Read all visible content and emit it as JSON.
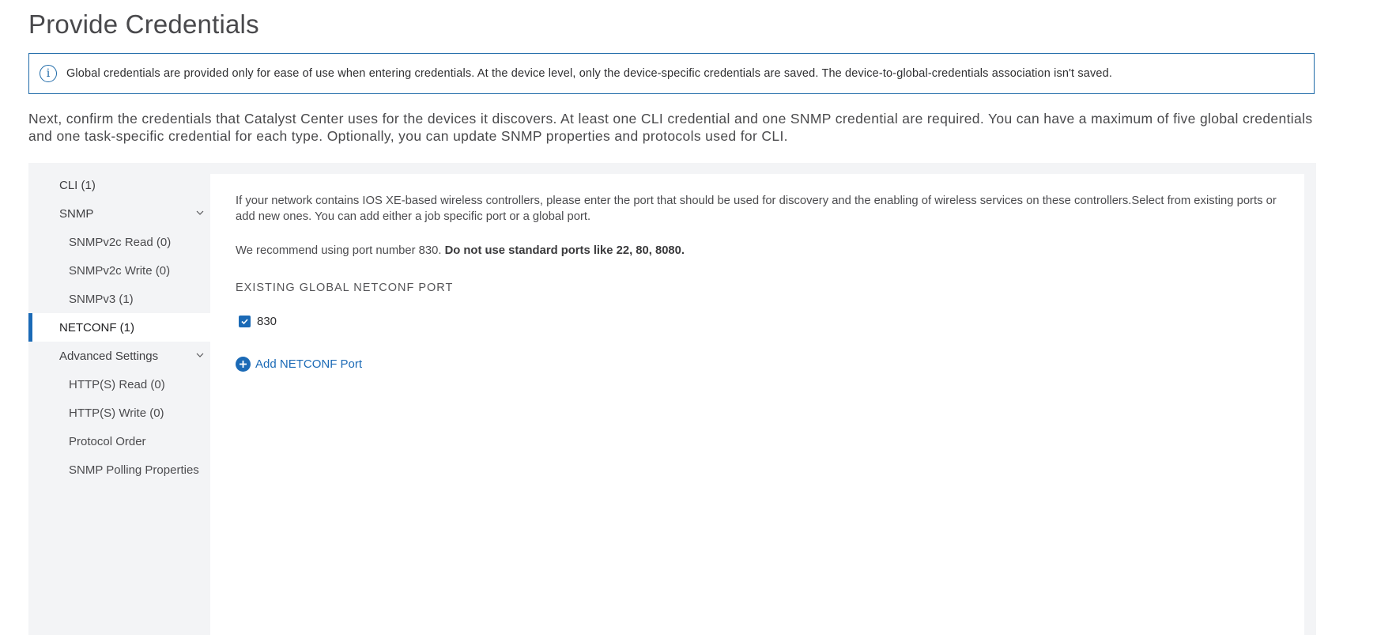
{
  "page": {
    "title": "Provide Credentials"
  },
  "banner": {
    "icon": "info-icon",
    "icon_glyph": "i",
    "text": "Global credentials are provided only for ease of use when entering credentials. At the device level, only the device-specific credentials are saved. The device-to-global-credentials association isn't saved.",
    "border_color": "#1e6aa8"
  },
  "intro": {
    "text": "Next, confirm the credentials that Catalyst Center uses for the devices it discovers. At least one CLI credential and one SNMP credential are required. You can have a maximum of five global credentials and one task-specific credential for each type. Optionally, you can update SNMP properties and protocols used for CLI."
  },
  "sidebar": {
    "items": [
      {
        "label": "CLI (1)",
        "level": 1
      },
      {
        "label": "SNMP",
        "level": 1,
        "expandable": true,
        "icon": "chevron-down-icon"
      },
      {
        "label": "SNMPv2c Read (0)",
        "level": 2
      },
      {
        "label": "SNMPv2c Write (0)",
        "level": 2
      },
      {
        "label": "SNMPv3 (1)",
        "level": 2
      },
      {
        "label": "NETCONF (1)",
        "level": 1,
        "active": true
      },
      {
        "label": "Advanced Settings",
        "level": 1,
        "expandable": true,
        "icon": "chevron-down-icon"
      },
      {
        "label": "HTTP(S) Read (0)",
        "level": 2
      },
      {
        "label": "HTTP(S) Write (0)",
        "level": 2
      },
      {
        "label": "Protocol Order",
        "level": 2
      },
      {
        "label": "SNMP Polling Properties",
        "level": 2
      }
    ]
  },
  "content": {
    "description": "If your network contains IOS XE-based wireless controllers, please enter the port that should be used for discovery and the enabling of wireless services on these controllers.Select from existing ports or add new ones. You can add either a job specific port or a global port.",
    "recommend_text": "We recommend using port number 830. ",
    "recommend_bold": "Do not use standard ports like 22, 80, 8080.",
    "section_heading": "EXISTING GLOBAL NETCONF PORT",
    "ports": [
      {
        "value": "830",
        "checked": true
      }
    ],
    "add_port_label": "Add NETCONF Port",
    "add_port_icon": "plus-circle-icon",
    "accent_color": "#1b6ab6"
  }
}
